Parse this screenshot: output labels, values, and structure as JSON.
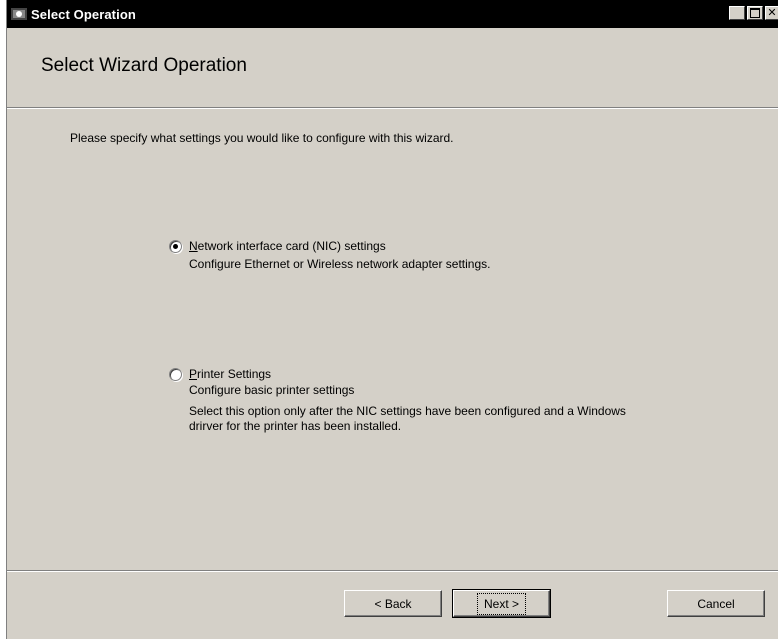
{
  "window": {
    "title": "Select Operation"
  },
  "header": {
    "title": "Select Wizard Operation"
  },
  "main": {
    "instruction": "Please specify what settings you would like to configure with this wizard.",
    "options": [
      {
        "label_accel": "N",
        "label_rest": "etwork interface card (NIC) settings",
        "description": "Configure Ethernet or Wireless network adapter settings.",
        "selected": true
      },
      {
        "label_accel": "P",
        "label_rest": "rinter Settings",
        "description": "Configure basic printer settings",
        "note_line1": "Select this option only after the NIC settings have been configured and a Windows",
        "note_line2": "drirver for the printer has been installed.",
        "selected": false
      }
    ]
  },
  "footer": {
    "back_label": "< Back",
    "next_label": "Next >",
    "cancel_label": "Cancel"
  }
}
